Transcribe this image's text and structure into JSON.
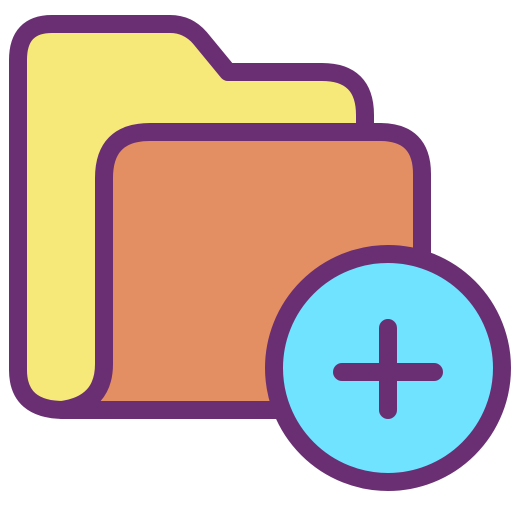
{
  "icon": {
    "name": "add-folder-icon",
    "parts": {
      "back_folder": "folder-back-icon",
      "front_folder": "folder-front-icon",
      "badge": "add-badge-icon",
      "plus": "plus-icon"
    },
    "colors": {
      "outline": "#6a2f73",
      "back_folder_fill": "#f6e97a",
      "front_folder_fill": "#e48f63",
      "badge_fill": "#6fe3ff",
      "background": "#ffffff"
    }
  }
}
